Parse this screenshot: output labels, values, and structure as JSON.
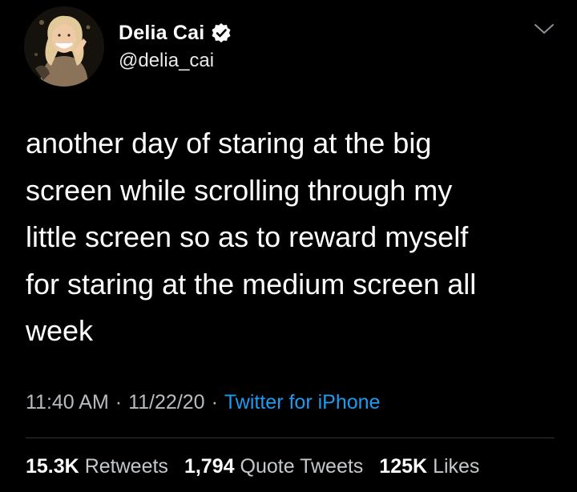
{
  "user": {
    "display_name": "Delia Cai",
    "handle": "@delia_cai",
    "verified_icon": "verified-badge-icon"
  },
  "tweet": {
    "text": "another day of staring at the big\nscreen while scrolling through my\nlittle screen so as to reward myself\nfor staring at the medium screen all\nweek",
    "time": "11:40 AM",
    "date": "11/22/20",
    "separator": "·",
    "source": "Twitter for iPhone"
  },
  "stats": {
    "retweets_count": "15.3K",
    "retweets_label": "Retweets",
    "quotes_count": "1,794",
    "quotes_label": "Quote Tweets",
    "likes_count": "125K",
    "likes_label": "Likes"
  },
  "colors": {
    "background": "#000000",
    "text": "#ffffff",
    "secondary": "#b8bcc0",
    "link": "#1d9bf0",
    "divider": "#2f3336"
  }
}
